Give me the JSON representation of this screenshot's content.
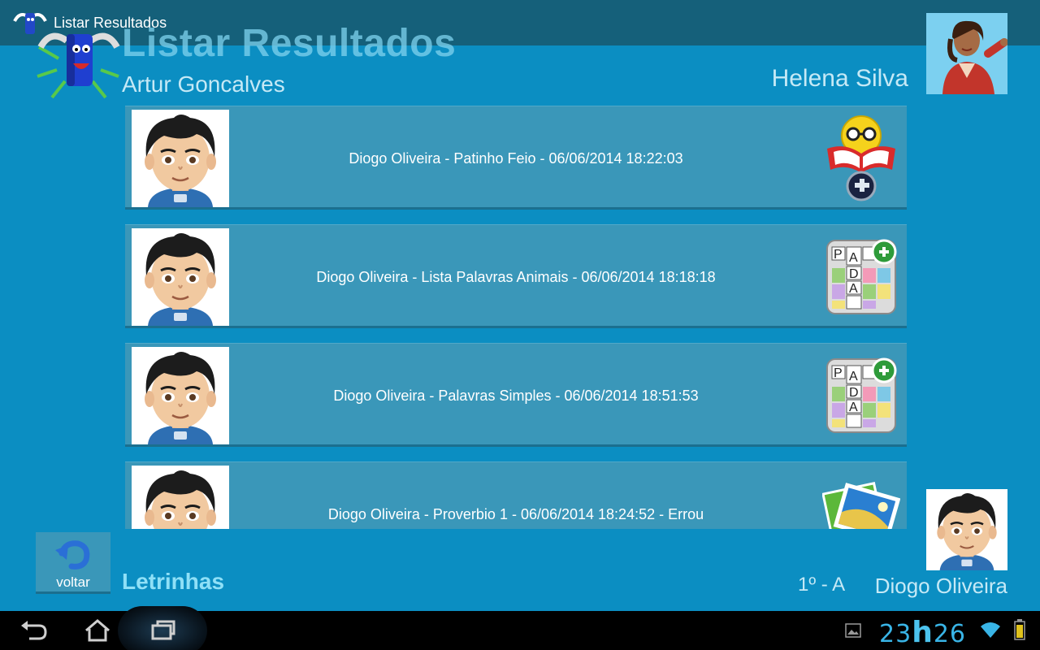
{
  "action_bar": {
    "title": "Listar Resultados",
    "app_icon": "letrinhas-logo-icon"
  },
  "header": {
    "title": "Listar Resultados",
    "subtitle": "Artur Goncalves",
    "teacher_name": "Helena Silva",
    "teacher_avatar": "teacher-avatar"
  },
  "results": [
    {
      "text": "Diogo Oliveira - Patinho Feio - 06/06/2014 18:22:03",
      "icon": "reading-test-icon"
    },
    {
      "text": "Diogo Oliveira - Lista Palavras Animais - 06/06/2014 18:18:18",
      "icon": "word-list-test-icon"
    },
    {
      "text": "Diogo Oliveira - Palavras Simples - 06/06/2014 18:51:53",
      "icon": "word-list-test-icon"
    },
    {
      "text": "Diogo Oliveira - Proverbio 1 - 06/06/2014 18:24:52 - Errou",
      "icon": "image-test-icon"
    }
  ],
  "footer": {
    "back_label": "voltar",
    "app_name": "Letrinhas",
    "class_label": "1º - A",
    "student_name": "Diogo Oliveira"
  },
  "system_bar": {
    "clock_hours": "23",
    "clock_sep": "h",
    "clock_minutes": "26"
  },
  "colors": {
    "background": "#0b8ec2",
    "action_bar": "#15607a",
    "row": "#3a97b9",
    "clock": "#39b4e6"
  }
}
